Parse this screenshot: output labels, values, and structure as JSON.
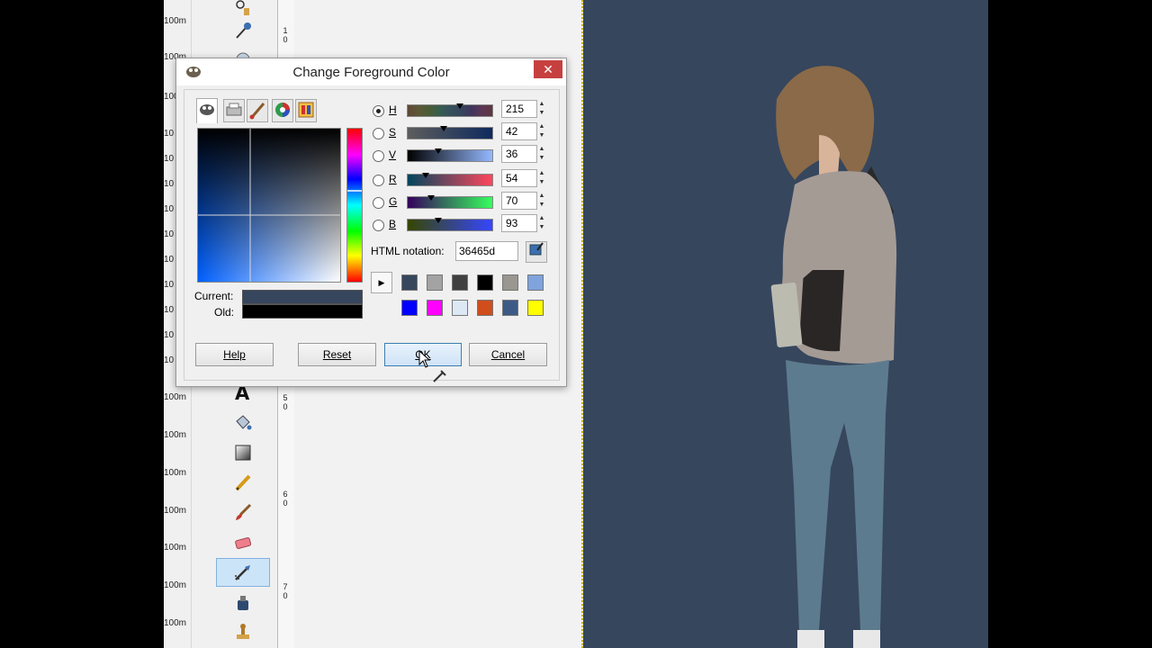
{
  "dialog": {
    "title": "Change Foreground Color",
    "close_symbol": "✕",
    "tabs": [
      "gimp-selector-icon",
      "cmyk-printer-icon",
      "watercolor-brush-icon",
      "color-wheel-icon",
      "scales-palette-icon"
    ],
    "sliders": [
      {
        "label": "H",
        "value": "215",
        "selected": true,
        "marker": 0.6
      },
      {
        "label": "S",
        "value": "42",
        "selected": false,
        "marker": 0.42
      },
      {
        "label": "V",
        "value": "36",
        "selected": false,
        "marker": 0.36
      },
      {
        "label": "R",
        "value": "54",
        "selected": false,
        "marker": 0.21
      },
      {
        "label": "G",
        "value": "70",
        "selected": false,
        "marker": 0.27
      },
      {
        "label": "B",
        "value": "93",
        "selected": false,
        "marker": 0.36
      }
    ],
    "html_notation_label": "HTML notation:",
    "html_notation_value": "36465d",
    "history_swatches": [
      "#36465d",
      "#a3a3a3",
      "#404040",
      "#000000",
      "#9a9690",
      "#7fa3dc",
      "#0000ff",
      "#ff00ff",
      "#dde8f5",
      "#d04d1c",
      "#3d5a86",
      "#ffff00"
    ],
    "current_label": "Current:",
    "old_label": "Old:",
    "current_color": "#36465d",
    "old_color": "#000000",
    "buttons": {
      "help": "Help",
      "reset": "Reset",
      "ok": "OK",
      "cancel": "Cancel"
    }
  },
  "row_labels": [
    "100m",
    "100m",
    "100m",
    "10",
    "10",
    "10",
    "10",
    "10",
    "10",
    "10",
    "10",
    "10",
    "10",
    "100m",
    "100m",
    "100m",
    "100m",
    "100m",
    "100m",
    "100m",
    "100m"
  ],
  "ruler_labels": [
    "1",
    "0",
    "5",
    "0",
    "6",
    "0",
    "7",
    "0"
  ],
  "toolbox_icons": [
    "fuzzy-select-icon",
    "color-picker-icon",
    "zoom-icon",
    "text-tool-icon",
    "bucket-fill-icon",
    "blend-icon",
    "pencil-icon",
    "paintbrush-icon",
    "eraser-icon",
    "airbrush-icon",
    "ink-icon",
    "clone-stamp-icon"
  ],
  "colors": {
    "image_background": "#36465d"
  }
}
